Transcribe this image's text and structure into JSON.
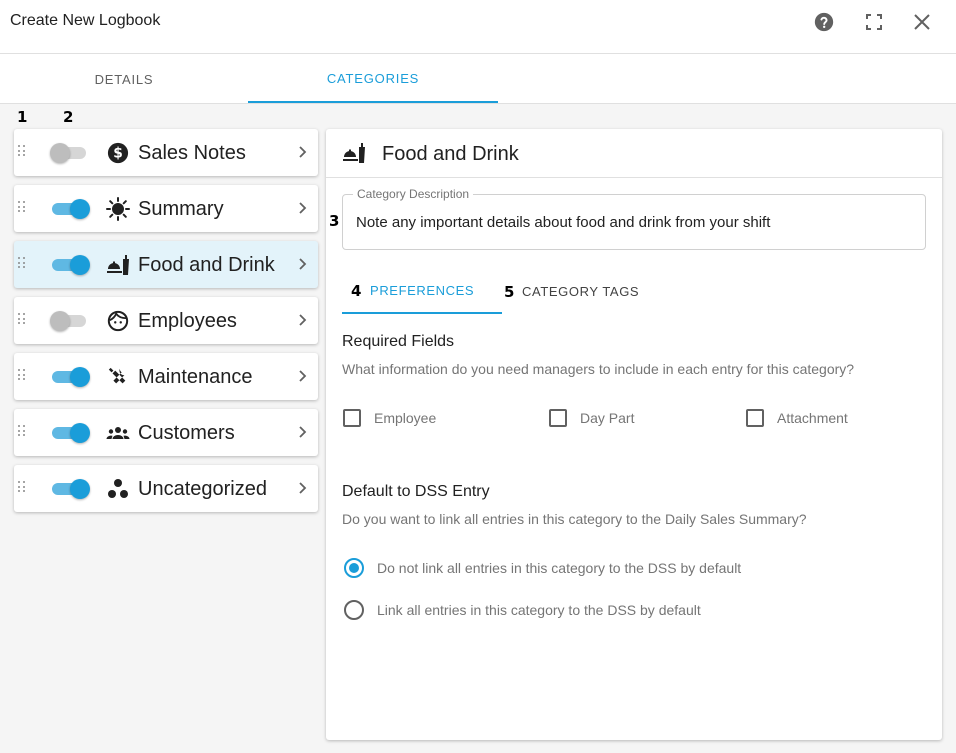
{
  "window": {
    "title": "Create New Logbook",
    "icons": [
      "help-icon",
      "fullscreen-icon",
      "close-icon"
    ]
  },
  "tabs": [
    {
      "label": "DETAILS",
      "active": false
    },
    {
      "label": "CATEGORIES",
      "active": true
    }
  ],
  "markers": {
    "m1": "1",
    "m2": "2",
    "m3": "3",
    "m4": "4",
    "m5": "5"
  },
  "categories": [
    {
      "label": "Sales Notes",
      "enabled": false,
      "icon": "dollar-circle-icon",
      "selected": false
    },
    {
      "label": "Summary",
      "enabled": true,
      "icon": "sun-icon",
      "selected": false
    },
    {
      "label": "Food and Drink",
      "enabled": true,
      "icon": "food-drink-icon",
      "selected": true
    },
    {
      "label": "Employees",
      "enabled": false,
      "icon": "face-icon",
      "selected": false
    },
    {
      "label": "Maintenance",
      "enabled": true,
      "icon": "tools-icon",
      "selected": false
    },
    {
      "label": "Customers",
      "enabled": true,
      "icon": "group-icon",
      "selected": false
    },
    {
      "label": "Uncategorized",
      "enabled": true,
      "icon": "scatter-dots-icon",
      "selected": false
    }
  ],
  "detail": {
    "title": "Food and Drink",
    "description_label": "Category Description",
    "description_value": "Note any important details about food and drink from your shift",
    "subtabs": [
      {
        "label": "PREFERENCES",
        "active": true
      },
      {
        "label": "CATEGORY TAGS",
        "active": false
      }
    ],
    "required_fields": {
      "title": "Required Fields",
      "subtitle": "What information do you need managers to include in each entry for this category?",
      "options": [
        {
          "label": "Employee",
          "checked": false
        },
        {
          "label": "Day Part",
          "checked": false
        },
        {
          "label": "Attachment",
          "checked": false
        }
      ]
    },
    "dss": {
      "title": "Default to DSS Entry",
      "subtitle": "Do you want to link all entries in this category to the Daily Sales Summary?",
      "options": [
        {
          "label": "Do not link all entries in this category to the DSS by default",
          "checked": true
        },
        {
          "label": "Link all entries in this category to the DSS by default",
          "checked": false
        }
      ]
    }
  },
  "colors": {
    "accent": "#1a9dd9",
    "selected_bg": "#e3f3fa",
    "muted_text": "#757575"
  }
}
